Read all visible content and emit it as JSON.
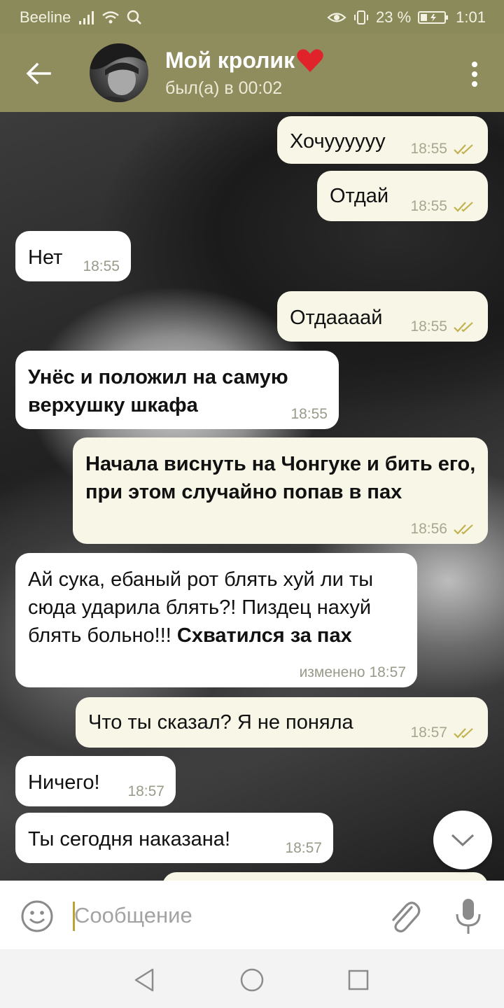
{
  "status_bar": {
    "carrier": "Beeline",
    "battery": "23 %",
    "time": "1:01"
  },
  "header": {
    "title": "Мой кролик",
    "title_emoji": "❤️",
    "subtitle": "был(а) в 00:02"
  },
  "messages": [
    {
      "direction": "out",
      "text": "Хочуууууу",
      "time": "18:55",
      "read": true
    },
    {
      "direction": "out",
      "text": "Отдай",
      "time": "18:55",
      "read": true
    },
    {
      "direction": "in",
      "text": "Нет",
      "time": "18:55"
    },
    {
      "direction": "out",
      "text": "Отдаааай",
      "time": "18:55",
      "read": true
    },
    {
      "direction": "in",
      "text": "Унёс и положил на самую верхушку шкафа",
      "time": "18:55",
      "bold": true
    },
    {
      "direction": "out",
      "text": "Начала виснуть на Чонгуке и бить его, при этом случайно попав в пах",
      "time": "18:56",
      "read": true,
      "bold": true
    },
    {
      "direction": "in",
      "text": "Ай сука, ебаный рот блять хуй ли ты сюда ударила блять?! Пиздец нахуй блять больно!!!",
      "bold_text": "Схватился за пах",
      "time": "изменено 18:57"
    },
    {
      "direction": "out",
      "text": "Что ты сказал? Я не поняла",
      "time": "18:57",
      "read": true
    },
    {
      "direction": "in",
      "text": "Ничего!",
      "time": "18:57"
    },
    {
      "direction": "in",
      "text": "Ты сегодня наказана!",
      "time": "18:57"
    }
  ],
  "input": {
    "placeholder": "Сообщение"
  },
  "colors": {
    "header_bg": "#8f8c5e",
    "status_bg": "#8a8a5a",
    "outgoing_bubble": "#f8f6e6",
    "incoming_bubble": "#ffffff",
    "check_color": "#c2b24f",
    "caret": "#b8a43a"
  },
  "icons": {
    "back": "arrow-left-icon",
    "more": "more-vertical-icon",
    "emoji": "smile-icon",
    "attach": "paperclip-icon",
    "mic": "microphone-icon",
    "scroll_down": "chevron-down-icon",
    "read_receipt": "double-check-icon",
    "nav_back": "triangle-back-icon",
    "nav_home": "circle-home-icon",
    "nav_recent": "square-recent-icon"
  }
}
